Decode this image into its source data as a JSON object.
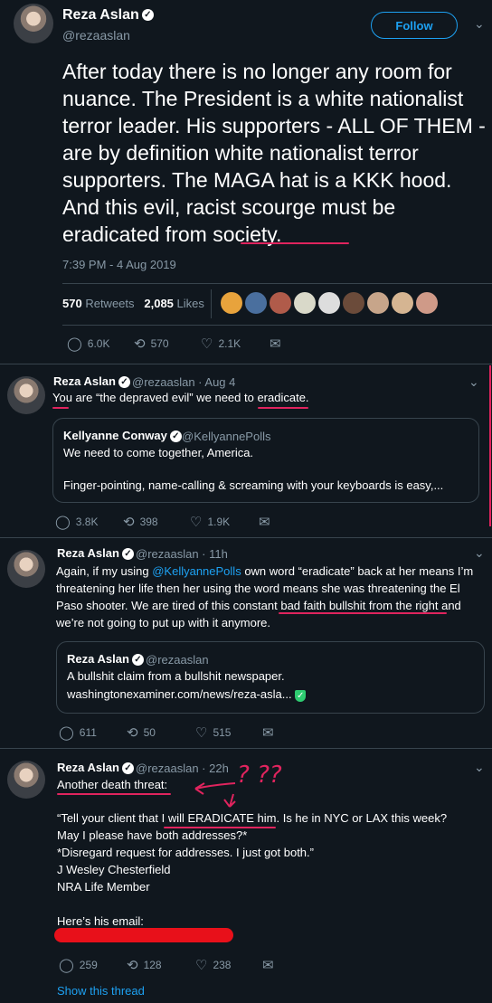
{
  "main_tweet": {
    "name": "Reza Aslan",
    "handle": "@rezaaslan",
    "follow_label": "Follow",
    "text": "After today there is no longer any room for nuance. The President is a white nationalist terror leader. His supporters - ALL OF THEM - are by definition white nationalist terror supporters. The MAGA hat is a KKK hood. And this evil, racist scourge must be eradicated from society.",
    "timestamp": "7:39 PM - 4 Aug 2019",
    "retweets_count": "570",
    "retweets_label": "Retweets",
    "likes_count": "2,085",
    "likes_label": "Likes",
    "replies": "6.0K",
    "retweets_short": "570",
    "likes_short": "2.1K"
  },
  "tweet2": {
    "name": "Reza Aslan",
    "handle_time": "@rezaaslan · Aug 4",
    "text": "You are “the depraved evil” we need to eradicate.",
    "quote": {
      "name": "Kellyanne Conway",
      "handle": "@KellyannePolls",
      "line1": "We need to come together, America.",
      "line2": "Finger-pointing, name-calling & screaming with your keyboards is easy,..."
    },
    "replies": "3.8K",
    "retweets": "398",
    "likes": "1.9K"
  },
  "tweet3": {
    "name": "Reza Aslan",
    "handle_time": "@rezaaslan · 11h",
    "text_before": "Again, if my using ",
    "mention": "@KellyannePolls",
    "text_after": " own word “eradicate” back at her means I’m threatening her life then her using the word means she was threatening the El Paso shooter. We are tired of this constant bad faith bullshit from the right and we’re not going to put up with it anymore.",
    "quote": {
      "name": "Reza Aslan",
      "handle": "@rezaaslan",
      "line1": "A bullshit claim from a bullshit newspaper.",
      "line2": "washingtonexaminer.com/news/reza-asla..."
    },
    "replies": "611",
    "retweets": "50",
    "likes": "515"
  },
  "tweet4": {
    "name": "Reza Aslan",
    "handle_time": "@rezaaslan · 22h",
    "line1": "Another death threat:",
    "annotation": "? ??",
    "line2": "“Tell your client that I will ERADICATE him. Is he in NYC or LAX this week?",
    "line3": "May I please have both addresses?*",
    "line4": "*Disregard request for addresses. I just got both.”",
    "line5": "J Wesley Chesterfield",
    "line6": "NRA Life Member",
    "line7": "Here’s his email:",
    "replies": "259",
    "retweets": "128",
    "likes": "238"
  },
  "show_thread": "Show this thread",
  "colors": {
    "background": "#10171e",
    "accent": "#1da1f2",
    "annotation_red": "#e0245e",
    "secondary_text": "#8899a6"
  }
}
